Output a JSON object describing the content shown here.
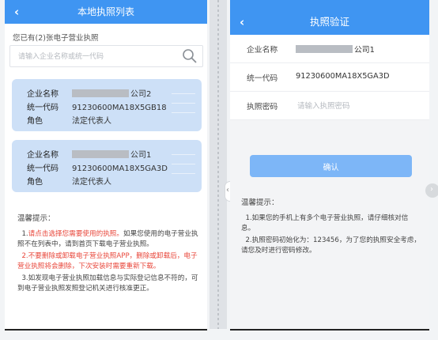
{
  "left": {
    "header": {
      "title": "本地执照列表",
      "back_icon": "‹"
    },
    "count_text": "您已有(2)张电子营业执照",
    "search": {
      "placeholder": "请输入企业名称或统一代码"
    },
    "cards": [
      {
        "name_label": "企业名称",
        "name_suffix": "公司2",
        "code_label": "统一代码",
        "code": "91230600MA18X5GB18",
        "role_label": "角色",
        "role": "法定代表人"
      },
      {
        "name_label": "企业名称",
        "name_suffix": "公司1",
        "code_label": "统一代码",
        "code": "91230600MA18X5GA3D",
        "role_label": "角色",
        "role": "法定代表人"
      }
    ],
    "tips": {
      "title": "温馨提示：",
      "t1_num": "1.",
      "t1_red": "请点击选择您需要使用的执照。",
      "t1_rest": "如果您使用的电子营业执照不在列表中，请到首页下载电子营业执照。",
      "t2": "2.不要删除或卸载电子营业执照APP，删除或卸载后，电子营业执照将会删除，下次安装时需要重新下载。",
      "t3": "3.如发现电子营业执照加载信息与实际登记信息不符的，可到电子营业执照发照登记机关进行核准更正。"
    }
  },
  "right": {
    "header": {
      "title": "执照验证",
      "back_icon": "‹"
    },
    "form": {
      "company_label": "企业名称",
      "company_suffix": "公司1",
      "code_label": "统一代码",
      "code": "91230600MA18X5GA3D",
      "password_label": "执照密码",
      "password_placeholder": "请输入执照密码"
    },
    "confirm_label": "确认",
    "tips": {
      "title": "温馨提示：",
      "t1": "1.如果您的手机上有多个电子营业执照，请仔细核对信息。",
      "t2": "2.执照密码初始化为：123456，为了您的执照安全考虑，请您及时进行密码修改。"
    }
  },
  "colors": {
    "primary": "#3f95f2",
    "card": "#cde0f7",
    "button": "#7db6f7",
    "warning": "#e8463a"
  }
}
